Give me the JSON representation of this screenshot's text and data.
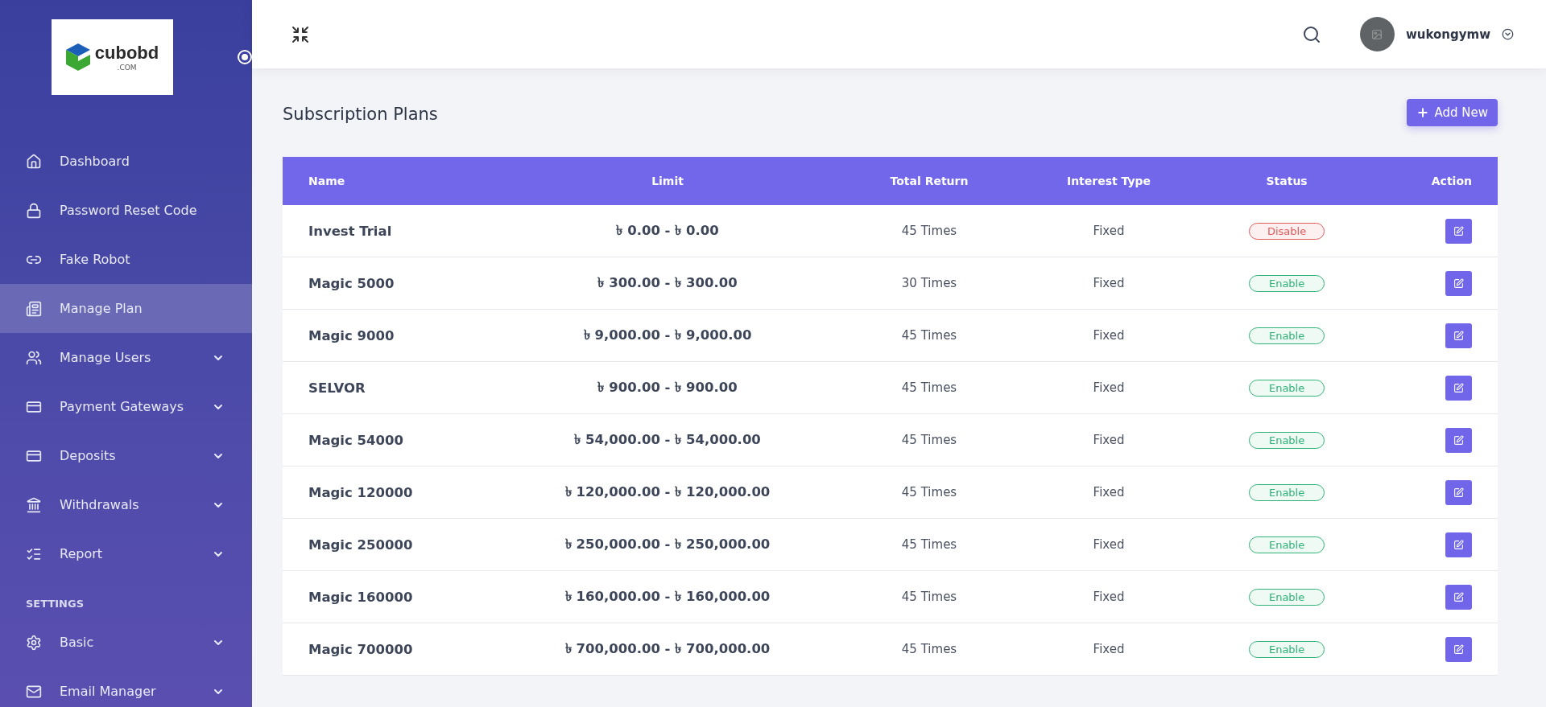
{
  "sidebar": {
    "logo": {
      "text": "cubobd",
      "subtext": ".COM"
    },
    "items": [
      {
        "label": "Dashboard",
        "selected": false,
        "expandable": false
      },
      {
        "label": "Password Reset Code",
        "selected": false,
        "expandable": false
      },
      {
        "label": "Fake Robot",
        "selected": false,
        "expandable": false
      },
      {
        "label": "Manage Plan",
        "selected": true,
        "expandable": false
      },
      {
        "label": "Manage Users",
        "selected": false,
        "expandable": true
      },
      {
        "label": "Payment Gateways",
        "selected": false,
        "expandable": true
      },
      {
        "label": "Deposits",
        "selected": false,
        "expandable": true
      },
      {
        "label": "Withdrawals",
        "selected": false,
        "expandable": true
      },
      {
        "label": "Report",
        "selected": false,
        "expandable": true
      }
    ],
    "section": "SETTINGS",
    "settings_items": [
      {
        "label": "Basic",
        "selected": false,
        "expandable": true
      },
      {
        "label": "Email Manager",
        "selected": false,
        "expandable": true
      }
    ]
  },
  "header": {
    "username": "wukongymw"
  },
  "page": {
    "title": "Subscription Plans",
    "add_button": "Add New"
  },
  "table": {
    "columns": [
      "Name",
      "Limit",
      "Total Return",
      "Interest Type",
      "Status",
      "Action"
    ],
    "rows": [
      {
        "name": "Invest Trial",
        "limit": "৳ 0.00 - ৳ 0.00",
        "total_return": "45 Times",
        "interest_type": "Fixed",
        "status": "Disable",
        "enabled": false
      },
      {
        "name": "Magic 5000",
        "limit": "৳ 300.00 - ৳ 300.00",
        "total_return": "30 Times",
        "interest_type": "Fixed",
        "status": "Enable",
        "enabled": true
      },
      {
        "name": "Magic 9000",
        "limit": "৳ 9,000.00 - ৳ 9,000.00",
        "total_return": "45 Times",
        "interest_type": "Fixed",
        "status": "Enable",
        "enabled": true
      },
      {
        "name": "SELVOR",
        "limit": "৳ 900.00 - ৳ 900.00",
        "total_return": "45 Times",
        "interest_type": "Fixed",
        "status": "Enable",
        "enabled": true
      },
      {
        "name": "Magic 54000",
        "limit": "৳ 54,000.00 - ৳ 54,000.00",
        "total_return": "45 Times",
        "interest_type": "Fixed",
        "status": "Enable",
        "enabled": true
      },
      {
        "name": "Magic 120000",
        "limit": "৳ 120,000.00 - ৳ 120,000.00",
        "total_return": "45 Times",
        "interest_type": "Fixed",
        "status": "Enable",
        "enabled": true
      },
      {
        "name": "Magic 250000",
        "limit": "৳ 250,000.00 - ৳ 250,000.00",
        "total_return": "45 Times",
        "interest_type": "Fixed",
        "status": "Enable",
        "enabled": true
      },
      {
        "name": "Magic 160000",
        "limit": "৳ 160,000.00 - ৳ 160,000.00",
        "total_return": "45 Times",
        "interest_type": "Fixed",
        "status": "Enable",
        "enabled": true
      },
      {
        "name": "Magic 700000",
        "limit": "৳ 700,000.00 - ৳ 700,000.00",
        "total_return": "45 Times",
        "interest_type": "Fixed",
        "status": "Enable",
        "enabled": true
      }
    ]
  }
}
